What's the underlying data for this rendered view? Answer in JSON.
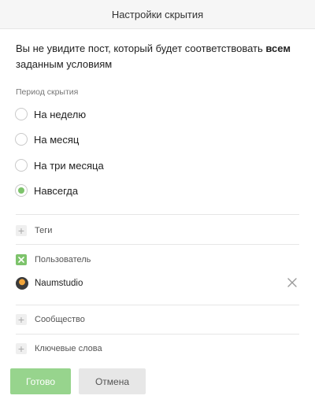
{
  "header": {
    "title": "Настройки скрытия"
  },
  "description": {
    "prefix": "Вы не увидите пост, который будет соответствовать ",
    "bold": "всем",
    "suffix": " заданным условиям"
  },
  "period": {
    "label": "Период скрытия",
    "options": [
      {
        "label": "На неделю",
        "selected": false
      },
      {
        "label": "На месяц",
        "selected": false
      },
      {
        "label": "На три месяца",
        "selected": false
      },
      {
        "label": "Навсегда",
        "selected": true
      }
    ]
  },
  "filters": {
    "tags": {
      "label": "Теги",
      "checked": false
    },
    "user": {
      "label": "Пользователь",
      "checked": true,
      "value": "Naumstudio"
    },
    "community": {
      "label": "Сообщество",
      "checked": false
    },
    "keywords": {
      "label": "Ключевые слова",
      "checked": false
    }
  },
  "buttons": {
    "ok": "Готово",
    "cancel": "Отмена"
  },
  "colors": {
    "accent": "#7dc36b",
    "ok_button": "#97d48d",
    "cancel_button": "#e7e7e7"
  }
}
